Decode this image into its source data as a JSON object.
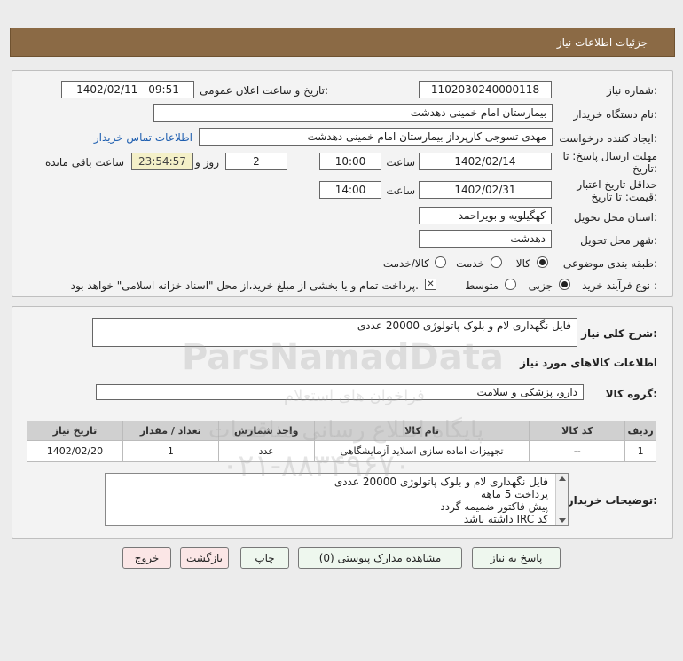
{
  "header": {
    "title": "جزئیات اطلاعات نیاز"
  },
  "form": {
    "need_number_label": "شماره نیاز:",
    "need_number": "1102030240000118",
    "announce_label": "تاریخ و ساعت اعلان عمومی:",
    "announce_value": "1402/02/11 - 09:51",
    "buyer_org_label": "نام دستگاه خریدار:",
    "buyer_org": "بیمارستان امام خمینی دهدشت",
    "creator_label": "ایجاد کننده درخواست:",
    "creator": "مهدی تسوجی کارپرداز بیمارستان امام خمینی دهدشت",
    "contact_link": "اطلاعات تماس خریدار",
    "deadline_label_1": "مهلت ارسال پاسخ: تا",
    "deadline_label_2": "تاریخ:",
    "deadline_date": "1402/02/14",
    "time_label": "ساعت",
    "deadline_time": "10:00",
    "days_value": "2",
    "days_label": "روز و",
    "remaining_time": "23:54:57",
    "remaining_label": "ساعت باقی مانده",
    "validity_label_1": "حداقل تاریخ اعتبار",
    "validity_label_2": "قیمت: تا تاریخ:",
    "validity_date": "1402/02/31",
    "validity_time_label": "ساعت",
    "validity_time": "14:00",
    "province_label": "استان محل تحویل:",
    "province": "کهگیلویه و بویراحمد",
    "city_label": "شهر محل تحویل:",
    "city": "دهدشت",
    "category_label": "طبقه بندی موضوعی:",
    "category_options": [
      "کالا",
      "خدمت",
      "کالا/خدمت"
    ],
    "process_label": "نوع فرآیند خرید :",
    "process_options": [
      "جزیی",
      "متوسط"
    ],
    "process_note": "پرداخت تمام و یا بخشی از مبلغ خرید،از محل \"اسناد خزانه اسلامی\" خواهد بود."
  },
  "summary": {
    "desc_label": "شرح کلی نیاز:",
    "desc_value": "فایل نگهداری لام و بلوک پاتولوژی 20000 عددی",
    "goods_info_title": "اطلاعات کالاهای مورد نیاز",
    "goods_group_label": "گروه کالا:",
    "goods_group": "دارو، پزشکی و سلامت"
  },
  "table": {
    "headers": [
      "ردیف",
      "کد کالا",
      "نام کالا",
      "واحد شمارش",
      "تعداد / مقدار",
      "تاریخ نیاز"
    ],
    "rows": [
      [
        "1",
        "--",
        "تجهیزات اماده سازی اسلاید آزمایشگاهی",
        "عدد",
        "1",
        "1402/02/20"
      ]
    ]
  },
  "notes": {
    "label": "توضیحات خریدار:",
    "lines": [
      "فایل نگهداری لام و بلوک پاتولوژی 20000 عددی",
      "پرداخت 5 ماهه",
      "پیش فاکتور ضمیمه گردد",
      "کد IRC داشته باشد"
    ]
  },
  "buttons": {
    "reply": "پاسخ به نیاز",
    "attachments": "مشاهده مدارک پیوستی (0)",
    "print": "چاپ",
    "back": "بازگشت",
    "exit": "خروج"
  },
  "watermark": {
    "brand": "ParsNamadData",
    "phone": "۰۲۱-۸۸۳۴۹۶۷۰",
    "line1": "پایگاه اطلاع رسانی مناقصات",
    "line2": "فراخوان های استعلام"
  },
  "colors": {
    "header_bg": "#8b6a45",
    "link": "#1f5fb0",
    "remaining_bg": "#f4f0c8"
  }
}
